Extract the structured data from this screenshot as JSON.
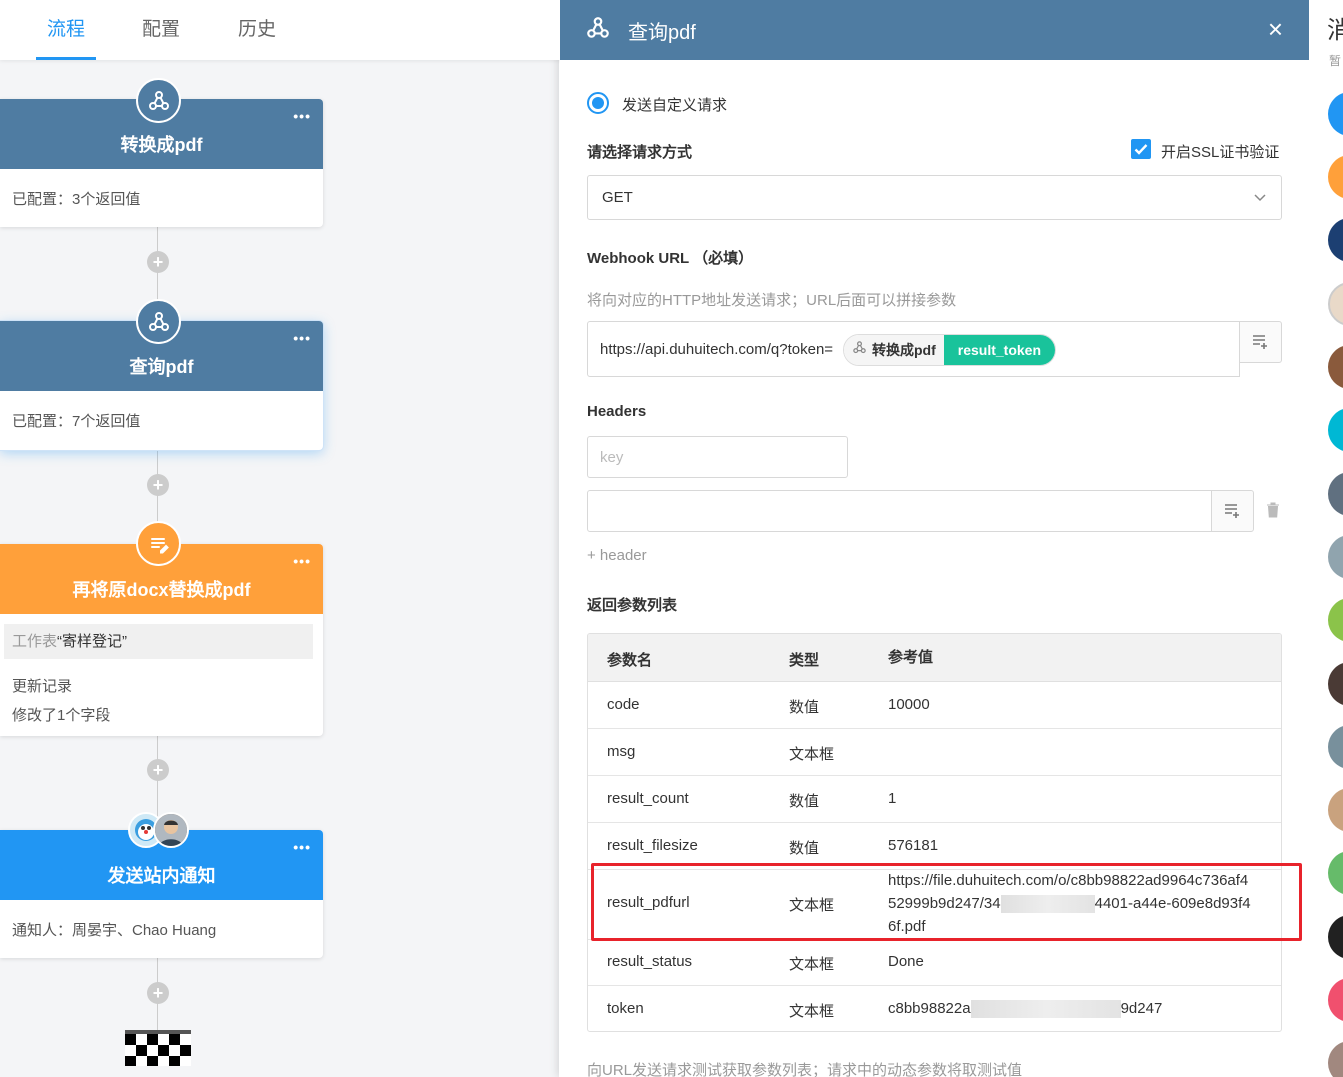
{
  "tabs": [
    "流程",
    "配置",
    "历史"
  ],
  "nodes": [
    {
      "title": "转换成pdf",
      "more": "•••",
      "desc": "已配置：3个返回值",
      "icon": "webhook-icon"
    },
    {
      "title": "查询pdf",
      "more": "•••",
      "desc": "已配置：7个返回值",
      "icon": "webhook-icon"
    },
    {
      "title": "再将原docx替换成pdf",
      "more": "•••",
      "sheet_prefix": "工作表",
      "sheet_name": "“寄样登记”",
      "line1": "更新记录",
      "line2": "修改了1个字段",
      "icon": "edit-icon"
    },
    {
      "title": "发送站内通知",
      "more": "•••",
      "desc": "通知人：周晏宇、Chao Huang",
      "icon": "avatar-group"
    }
  ],
  "panel": {
    "title": "查询pdf",
    "close": "×",
    "radio_label": "发送自定义请求",
    "method_label": "请选择请求方式",
    "ssl_label": "开启SSL证书验证",
    "method_value": "GET",
    "url_label": "Webhook URL （必填）",
    "url_hint": "将向对应的HTTP地址发送请求；URL后面可以拼接参数",
    "url_value": "https://api.duhuitech.com/q?token=",
    "chip_node": "转换成pdf",
    "chip_field": "result_token",
    "headers_label": "Headers",
    "key_placeholder": "key",
    "add_header": "+ header",
    "return_label": "返回参数列表",
    "table_headers": [
      "参数名",
      "类型",
      "参考值"
    ],
    "rows": [
      {
        "name": "code",
        "type": "数值",
        "value": "10000"
      },
      {
        "name": "msg",
        "type": "文本框",
        "value": ""
      },
      {
        "name": "result_count",
        "type": "数值",
        "value": "1"
      },
      {
        "name": "result_filesize",
        "type": "数值",
        "value": "576181"
      },
      {
        "name": "result_pdfurl",
        "type": "文本框",
        "value_line1": "https://file.duhuitech.com/o/c8bb98822ad9964c736af4",
        "value_line2a": "52999b9d247/34",
        "value_line2b": "4401-a44e-609e8d93f4",
        "value_line3": "6f.pdf"
      },
      {
        "name": "result_status",
        "type": "文本框",
        "value": "Done"
      },
      {
        "name": "token",
        "type": "文本框",
        "value_a": "c8bb98822a",
        "value_b": "9d247"
      }
    ],
    "footer_hint": "向URL发送请求测试获取参数列表；请求中的动态参数将取测试值"
  },
  "right_sidebar": {
    "title": "消",
    "subtitle": "暂"
  },
  "colors": {
    "primary": "#2196f3",
    "header": "#4f7ca2",
    "orange": "#ffa03a",
    "green": "#19c39b",
    "highlight": "#e8232b"
  }
}
